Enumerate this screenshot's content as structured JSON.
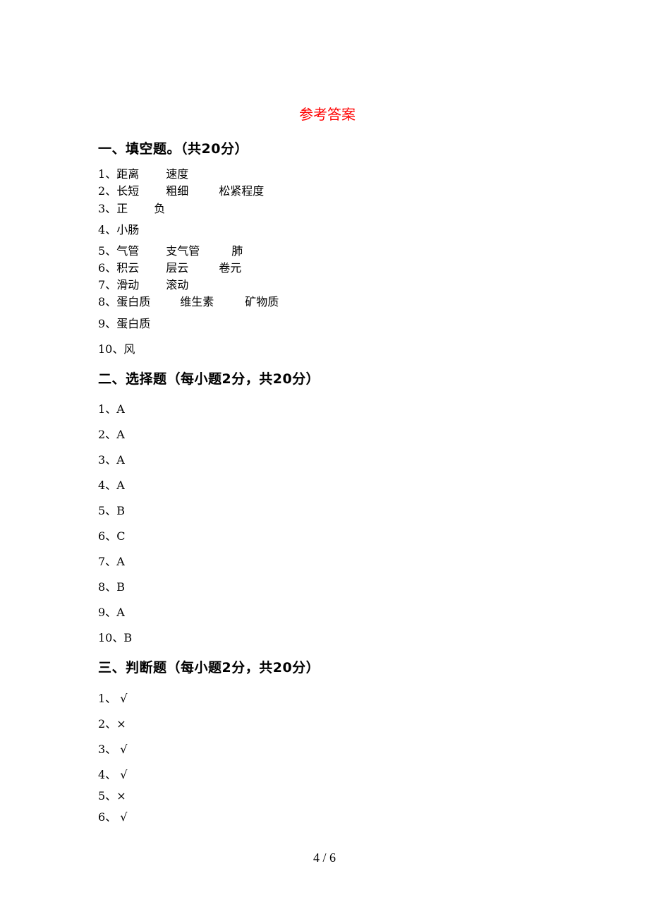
{
  "title": "参考答案",
  "section1": {
    "heading": "一、填空题。（共20分）",
    "items": [
      {
        "num": "1、",
        "answers": [
          "距离",
          "速度"
        ]
      },
      {
        "num": "2、",
        "answers": [
          "长短",
          "粗细",
          "松紧程度"
        ]
      },
      {
        "num": "3、",
        "answers": [
          "正",
          "负"
        ]
      },
      {
        "num": "4、",
        "answers": [
          "小肠"
        ]
      },
      {
        "num": "5、",
        "answers": [
          "气管",
          "支气管",
          "肺"
        ]
      },
      {
        "num": "6、",
        "answers": [
          "积云",
          "层云",
          "卷元"
        ]
      },
      {
        "num": "7、",
        "answers": [
          "滑动",
          "滚动"
        ]
      },
      {
        "num": "8、",
        "answers": [
          "蛋白质",
          "维生素",
          "矿物质"
        ]
      },
      {
        "num": "9、",
        "answers": [
          "蛋白质"
        ]
      },
      {
        "num": "10、",
        "answers": [
          "风"
        ]
      }
    ]
  },
  "section2": {
    "heading": "二、选择题（每小题2分，共20分）",
    "items": [
      {
        "num": "1、",
        "answer": "A"
      },
      {
        "num": "2、",
        "answer": "A"
      },
      {
        "num": "3、",
        "answer": "A"
      },
      {
        "num": "4、",
        "answer": "A"
      },
      {
        "num": "5、",
        "answer": "B"
      },
      {
        "num": "6、",
        "answer": "C"
      },
      {
        "num": "7、",
        "answer": "A"
      },
      {
        "num": "8、",
        "answer": "B"
      },
      {
        "num": "9、",
        "answer": "A"
      },
      {
        "num": "10、",
        "answer": "B"
      }
    ]
  },
  "section3": {
    "heading": "三、判断题（每小题2分，共20分）",
    "items": [
      {
        "num": "1、",
        "answer": "√"
      },
      {
        "num": "2、",
        "answer": "×"
      },
      {
        "num": "3、",
        "answer": "√"
      },
      {
        "num": "4、",
        "answer": "√"
      },
      {
        "num": "5、",
        "answer": "×"
      },
      {
        "num": "6、",
        "answer": "√"
      }
    ]
  },
  "footer": {
    "page": "4 / 6"
  }
}
